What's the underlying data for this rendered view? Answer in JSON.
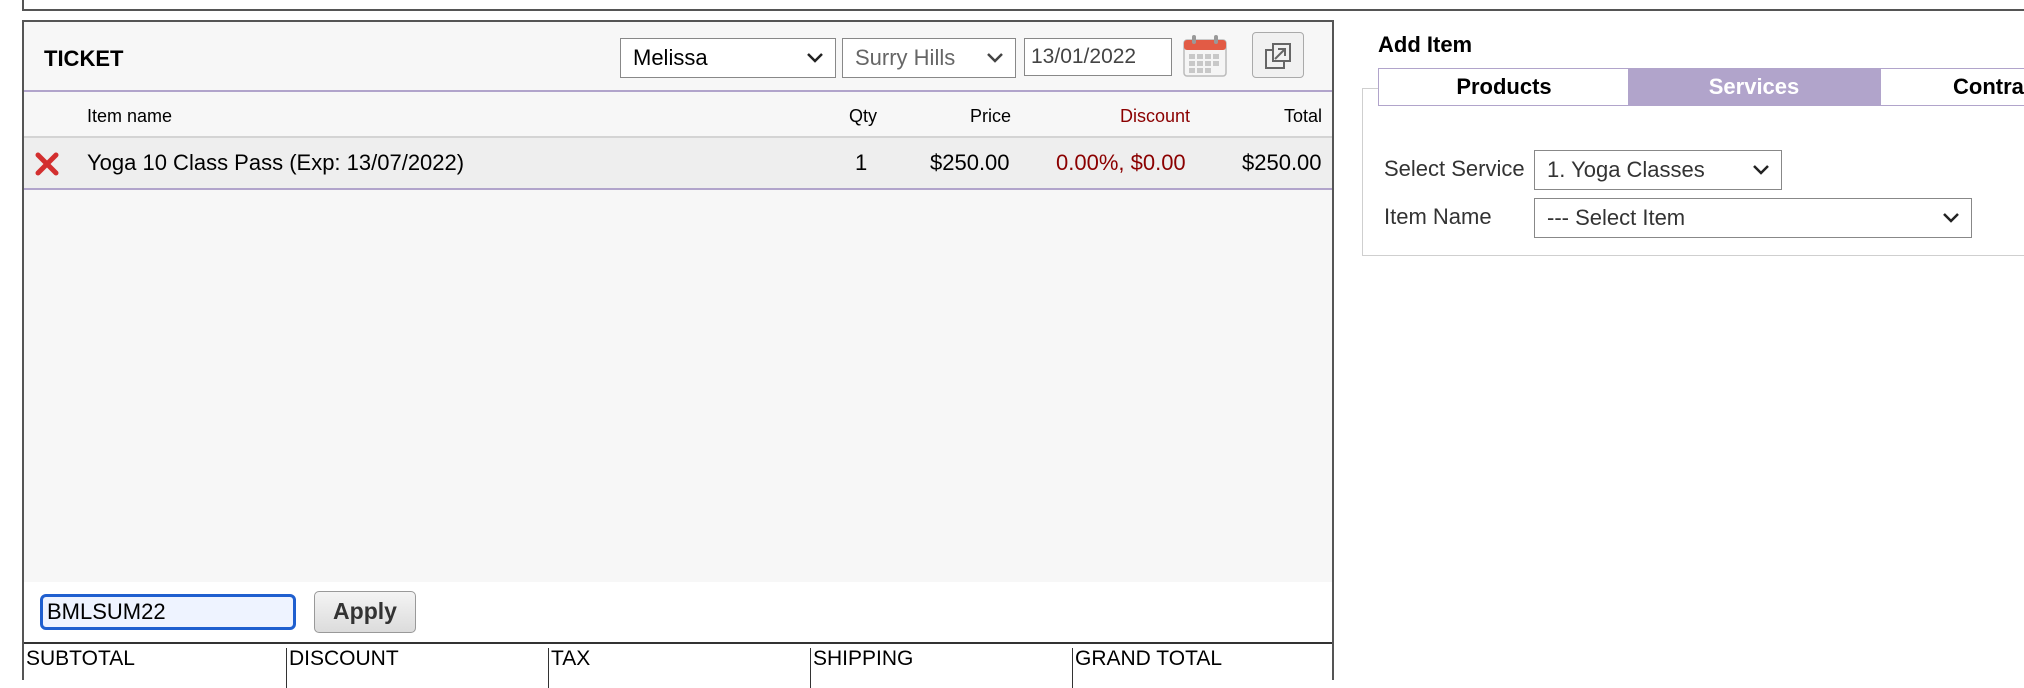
{
  "ticket": {
    "title": "TICKET",
    "staff_selected": "Melissa",
    "location_selected": "Surry Hills",
    "date": "13/01/2022",
    "columns": {
      "item_name": "Item name",
      "qty": "Qty",
      "price": "Price",
      "discount": "Discount",
      "total": "Total"
    },
    "items": [
      {
        "name": "Yoga 10 Class Pass (Exp: 13/07/2022)",
        "qty": "1",
        "price": "$250.00",
        "discount": "0.00%, $0.00",
        "total": "$250.00"
      }
    ],
    "promo_code": "BMLSUM22",
    "apply_label": "Apply",
    "totals": {
      "subtotal": "SUBTOTAL",
      "discount": "DISCOUNT",
      "tax": "TAX",
      "shipping": "SHIPPING",
      "grand_total": "GRAND TOTAL"
    }
  },
  "add_item": {
    "title": "Add Item",
    "tabs": [
      {
        "label": "Products",
        "active": false
      },
      {
        "label": "Services",
        "active": true
      },
      {
        "label": "Contra",
        "active": false
      }
    ],
    "select_service_label": "Select Service",
    "select_service_value": "1. Yoga Classes",
    "item_name_label": "Item Name",
    "item_name_value": "--- Select Item"
  },
  "colors": {
    "accent_purple": "#b1a4cb",
    "discount_red": "#8b0000",
    "focus_blue": "#1f5fcf",
    "remove_red": "#d32f2f"
  },
  "icons": {
    "remove": "close-x-icon",
    "calendar": "calendar-icon",
    "popout": "popout-icon",
    "dropdown": "chevron-down-icon"
  }
}
